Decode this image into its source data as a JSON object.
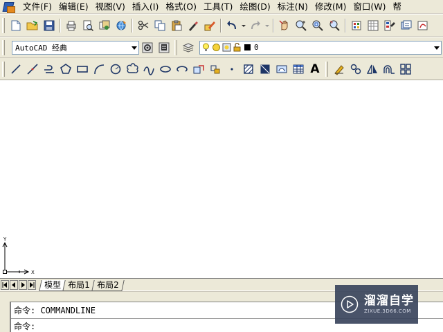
{
  "menubar": {
    "items": [
      "文件(F)",
      "编辑(E)",
      "视图(V)",
      "插入(I)",
      "格式(O)",
      "工具(T)",
      "绘图(D)",
      "标注(N)",
      "修改(M)",
      "窗口(W)",
      "帮"
    ]
  },
  "toolbar_workspace": {
    "value": "AutoCAD 经典"
  },
  "toolbar_layer": {
    "value": "0"
  },
  "draw_toolbar": {
    "text_button": "A"
  },
  "ucs": {
    "x_label": "X",
    "y_label": "Y"
  },
  "layout_tabs": [
    "模型",
    "布局1",
    "布局2"
  ],
  "command": {
    "line1": "命令: COMMANDLINE",
    "line2": "命令:"
  },
  "watermark": {
    "name": "溜溜自学",
    "url": "ZIXUE.3D66.COM"
  },
  "colors": {
    "toolbar_bg": "#ece9d8",
    "canvas_bg": "#ffffff",
    "watermark_bg": "#3a445c"
  }
}
